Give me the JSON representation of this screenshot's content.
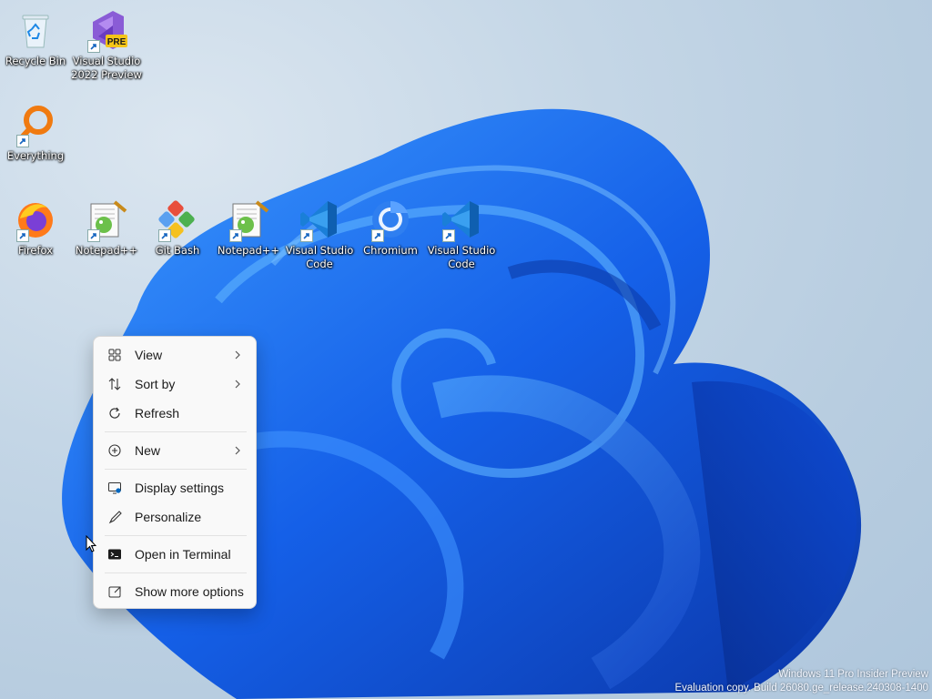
{
  "desktop": {
    "icons": [
      {
        "label": "Recycle Bin",
        "icon": "recycle-bin-icon"
      },
      {
        "label": "Visual Studio\n2022 Preview",
        "icon": "visual-studio-preview-icon",
        "badge": "PRE"
      },
      {
        "label": "Everything",
        "icon": "everything-search-icon"
      },
      {
        "label": "Firefox",
        "icon": "firefox-icon"
      },
      {
        "label": "Notepad++",
        "icon": "notepad-plus-plus-icon"
      },
      {
        "label": "Git Bash",
        "icon": "git-bash-icon"
      },
      {
        "label": "Notepad++",
        "icon": "notepad-plus-plus-icon"
      },
      {
        "label": "Visual Studio\nCode",
        "icon": "vscode-icon"
      },
      {
        "label": "Chromium",
        "icon": "chromium-icon"
      },
      {
        "label": "Visual Studio\nCode",
        "icon": "vscode-icon"
      }
    ]
  },
  "context_menu": {
    "items": [
      {
        "label": "View",
        "icon": "view-grid-icon",
        "submenu": true
      },
      {
        "label": "Sort by",
        "icon": "sort-icon",
        "submenu": true
      },
      {
        "label": "Refresh",
        "icon": "refresh-icon",
        "submenu": false
      },
      {
        "label": "New",
        "icon": "new-plus-icon",
        "submenu": true
      },
      {
        "label": "Display settings",
        "icon": "display-settings-icon",
        "submenu": false
      },
      {
        "label": "Personalize",
        "icon": "personalize-brush-icon",
        "submenu": false
      },
      {
        "label": "Open in Terminal",
        "icon": "terminal-icon",
        "submenu": false
      },
      {
        "label": "Show more options",
        "icon": "show-more-options-icon",
        "submenu": false
      }
    ]
  },
  "watermark": {
    "line1": "Windows 11 Pro Insider Preview",
    "line2": "Evaluation copy. Build 26080.ge_release.240308-1400"
  },
  "colors": {
    "accent": "#0067c0",
    "bloom_dark": "#0a3fb5",
    "bloom_light": "#3a8ef5"
  }
}
